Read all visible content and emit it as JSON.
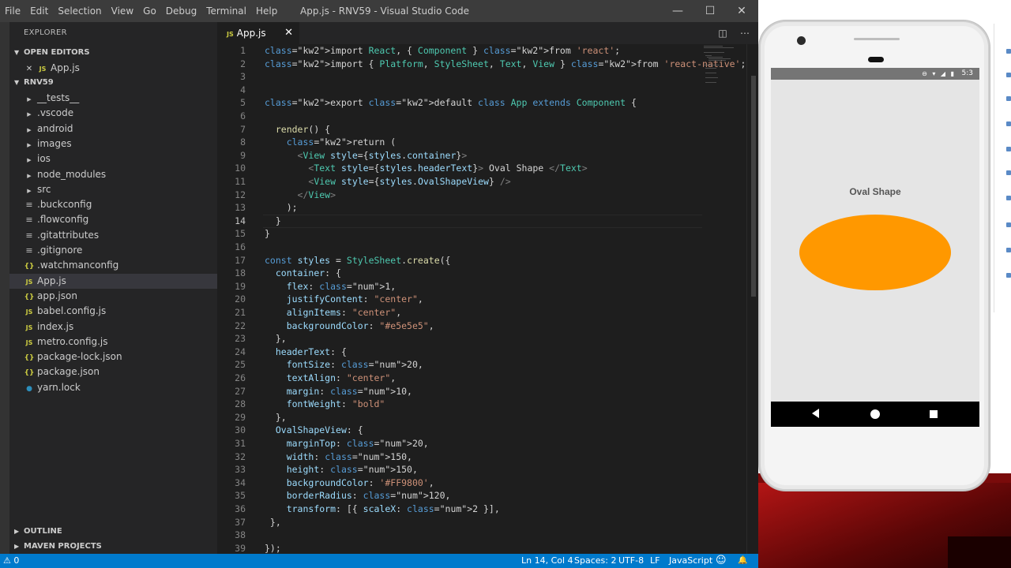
{
  "window": {
    "title": "App.js - RNV59 - Visual Studio Code",
    "menu": [
      "File",
      "Edit",
      "Selection",
      "View",
      "Go",
      "Debug",
      "Terminal",
      "Help"
    ],
    "controls": {
      "minimize": "—",
      "maximize": "☐",
      "close": "✕"
    }
  },
  "sidebar": {
    "title": "EXPLORER",
    "open_editors_label": "OPEN EDITORS",
    "open_editor_file": "App.js",
    "project_label": "RNV59",
    "items": [
      {
        "label": "__tests__",
        "icon": "chevron-right-icon",
        "kind": "folder"
      },
      {
        "label": ".vscode",
        "icon": "chevron-right-icon",
        "kind": "folder"
      },
      {
        "label": "android",
        "icon": "chevron-right-icon",
        "kind": "folder"
      },
      {
        "label": "images",
        "icon": "chevron-right-icon",
        "kind": "folder"
      },
      {
        "label": "ios",
        "icon": "chevron-right-icon",
        "kind": "folder"
      },
      {
        "label": "node_modules",
        "icon": "chevron-right-icon",
        "kind": "folder"
      },
      {
        "label": "src",
        "icon": "chevron-right-icon",
        "kind": "folder"
      },
      {
        "label": ".buckconfig",
        "icon": "config-file-icon",
        "kind": "cfg"
      },
      {
        "label": ".flowconfig",
        "icon": "config-file-icon",
        "kind": "cfg"
      },
      {
        "label": ".gitattributes",
        "icon": "git-file-icon",
        "kind": "cfg"
      },
      {
        "label": ".gitignore",
        "icon": "git-file-icon",
        "kind": "cfg"
      },
      {
        "label": ".watchmanconfig",
        "icon": "json-file-icon",
        "kind": "json"
      },
      {
        "label": "App.js",
        "icon": "js-file-icon",
        "kind": "js",
        "active": true
      },
      {
        "label": "app.json",
        "icon": "json-file-icon",
        "kind": "json"
      },
      {
        "label": "babel.config.js",
        "icon": "js-file-icon",
        "kind": "js"
      },
      {
        "label": "index.js",
        "icon": "js-file-icon",
        "kind": "js"
      },
      {
        "label": "metro.config.js",
        "icon": "js-file-icon",
        "kind": "js"
      },
      {
        "label": "package-lock.json",
        "icon": "json-file-icon",
        "kind": "json"
      },
      {
        "label": "package.json",
        "icon": "json-file-icon",
        "kind": "json"
      },
      {
        "label": "yarn.lock",
        "icon": "yarn-file-icon",
        "kind": "yarn"
      }
    ],
    "outline_label": "OUTLINE",
    "maven_label": "MAVEN PROJECTS"
  },
  "tab": {
    "label": "App.js",
    "badge": "JS"
  },
  "editor": {
    "current_line": 14,
    "lines": [
      "import React, { Component } from 'react';",
      "import { Platform, StyleSheet, Text, View } from 'react-native';",
      "",
      "",
      "export default class App extends Component {",
      "",
      "  render() {",
      "    return (",
      "      <View style={styles.container}>",
      "        <Text style={styles.headerText}> Oval Shape </Text>",
      "        <View style={styles.OvalShapeView} />",
      "      </View>",
      "    );",
      "  }",
      "}",
      "",
      "const styles = StyleSheet.create({",
      "  container: {",
      "    flex: 1,",
      "    justifyContent: \"center\",",
      "    alignItems: \"center\",",
      "    backgroundColor: \"#e5e5e5\",",
      "  },",
      "  headerText: {",
      "    fontSize: 20,",
      "    textAlign: \"center\",",
      "    margin: 10,",
      "    fontWeight: \"bold\"",
      "  },",
      "  OvalShapeView: {",
      "    marginTop: 20,",
      "    width: 150,",
      "    height: 150,",
      "    backgroundColor: '#FF9800',",
      "    borderRadius: 120,",
      "    transform: [{ scaleX: 2 }],",
      " },",
      "",
      "});"
    ]
  },
  "statusbar": {
    "problems": "⚠ 0",
    "position": "Ln 14, Col 4",
    "spaces": "Spaces: 2",
    "encoding": "UTF-8",
    "eol": "LF",
    "language": "JavaScript",
    "smiley": "☺",
    "bell": "🔔"
  },
  "phone": {
    "status_time": "5:3",
    "status_icons": "⊖ ▾ ◢ ▮",
    "header_text": "Oval Shape",
    "oval_color": "#FF9800",
    "screen_bg": "#e5e5e5"
  },
  "colors": {
    "accent": "#007acc",
    "editor_bg": "#1e1e1e",
    "sidebar_bg": "#252526"
  }
}
